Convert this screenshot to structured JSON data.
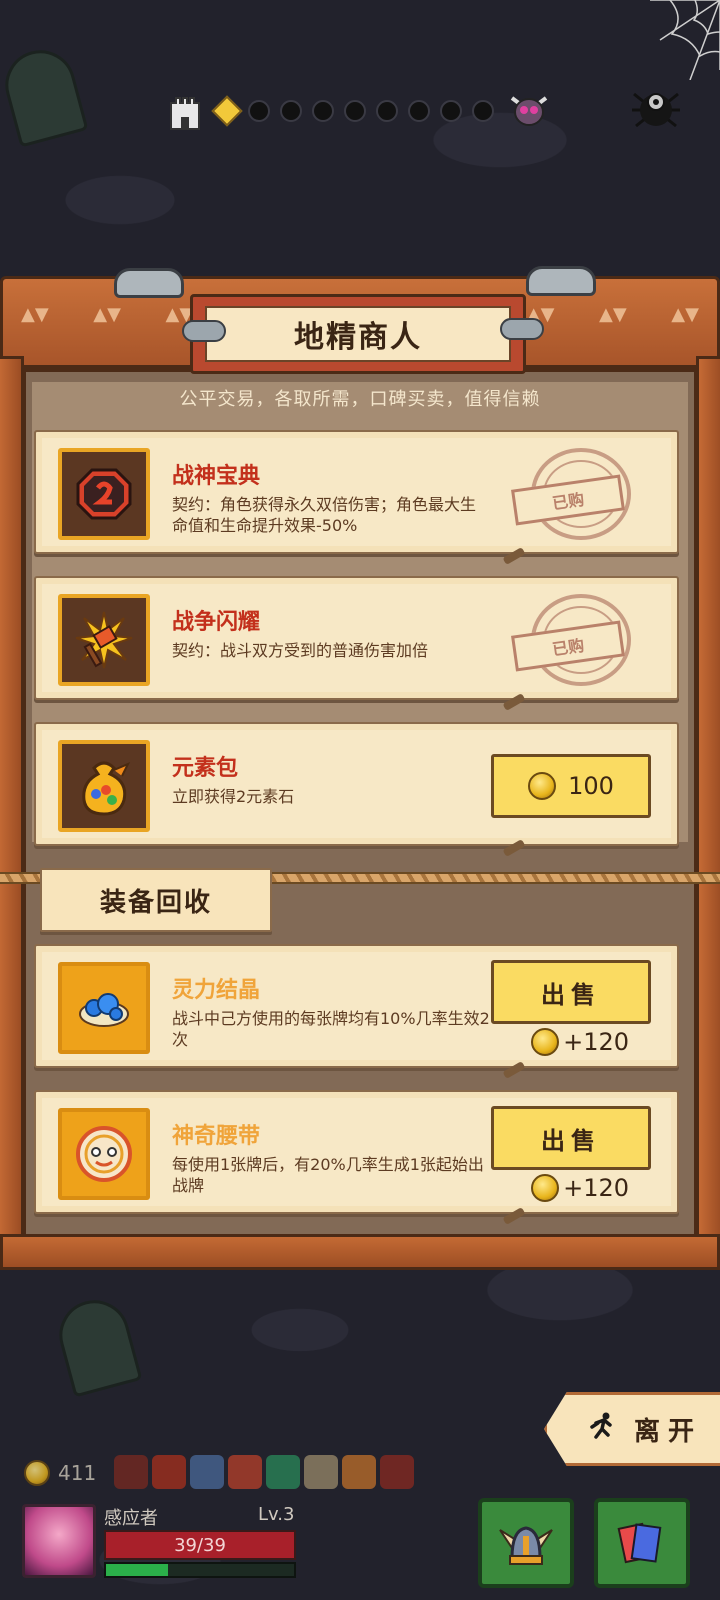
{
  "colors": {
    "accent_red": "#c3301c",
    "rarity_gold": "#f0a43a",
    "button_yellow": "#fadb62",
    "hp_red": "#a8202a",
    "xp_green": "#2bb04a"
  },
  "map": {
    "icons": [
      "castle-icon",
      "current-node-diamond",
      "boss-skull-icon",
      "settings-gear-icon"
    ]
  },
  "shop": {
    "title": "地精商人",
    "subtitle": "公平交易，各取所需，口碑买卖，值得信赖",
    "items": [
      {
        "name": "战神宝典",
        "desc": "契约：角色获得永久双倍伤害；角色最大生命值和生命提升效果-50%",
        "icon": "war-god-tome-icon",
        "status": "已购"
      },
      {
        "name": "战争闪耀",
        "desc": "契约：战斗双方受到的普通伤害加倍",
        "icon": "war-flare-icon",
        "status": "已购"
      },
      {
        "name": "元素包",
        "desc": "立即获得2元素石",
        "icon": "element-bag-icon",
        "price": "100"
      }
    ]
  },
  "recycle": {
    "title": "装备回收",
    "items": [
      {
        "name": "灵力结晶",
        "desc": "战斗中己方使用的每张牌均有10%几率生效2次",
        "icon": "spirit-crystal-icon",
        "sell_label": "出售",
        "sell_price": "+120"
      },
      {
        "name": "神奇腰带",
        "desc": "每使用1张牌后，有20%几率生成1张起始出战牌",
        "icon": "magic-belt-icon",
        "sell_label": "出售",
        "sell_price": "+120"
      }
    ]
  },
  "leave_button": {
    "label": "离开",
    "icon": "running-man-icon"
  },
  "player": {
    "gold": "411",
    "name": "感应者",
    "level": "Lv.3",
    "hp": "39/39",
    "xp_fraction": 0.33,
    "relics": [
      "red-rune-relic",
      "flame-relic",
      "blue-rune-relic",
      "spark-relic",
      "green-orb-relic",
      "skull-relic",
      "fire-relic",
      "red-seal-relic"
    ]
  },
  "hud": {
    "deck_icon": "winged-helmet-icon",
    "cards_icon": "card-stack-icon"
  }
}
